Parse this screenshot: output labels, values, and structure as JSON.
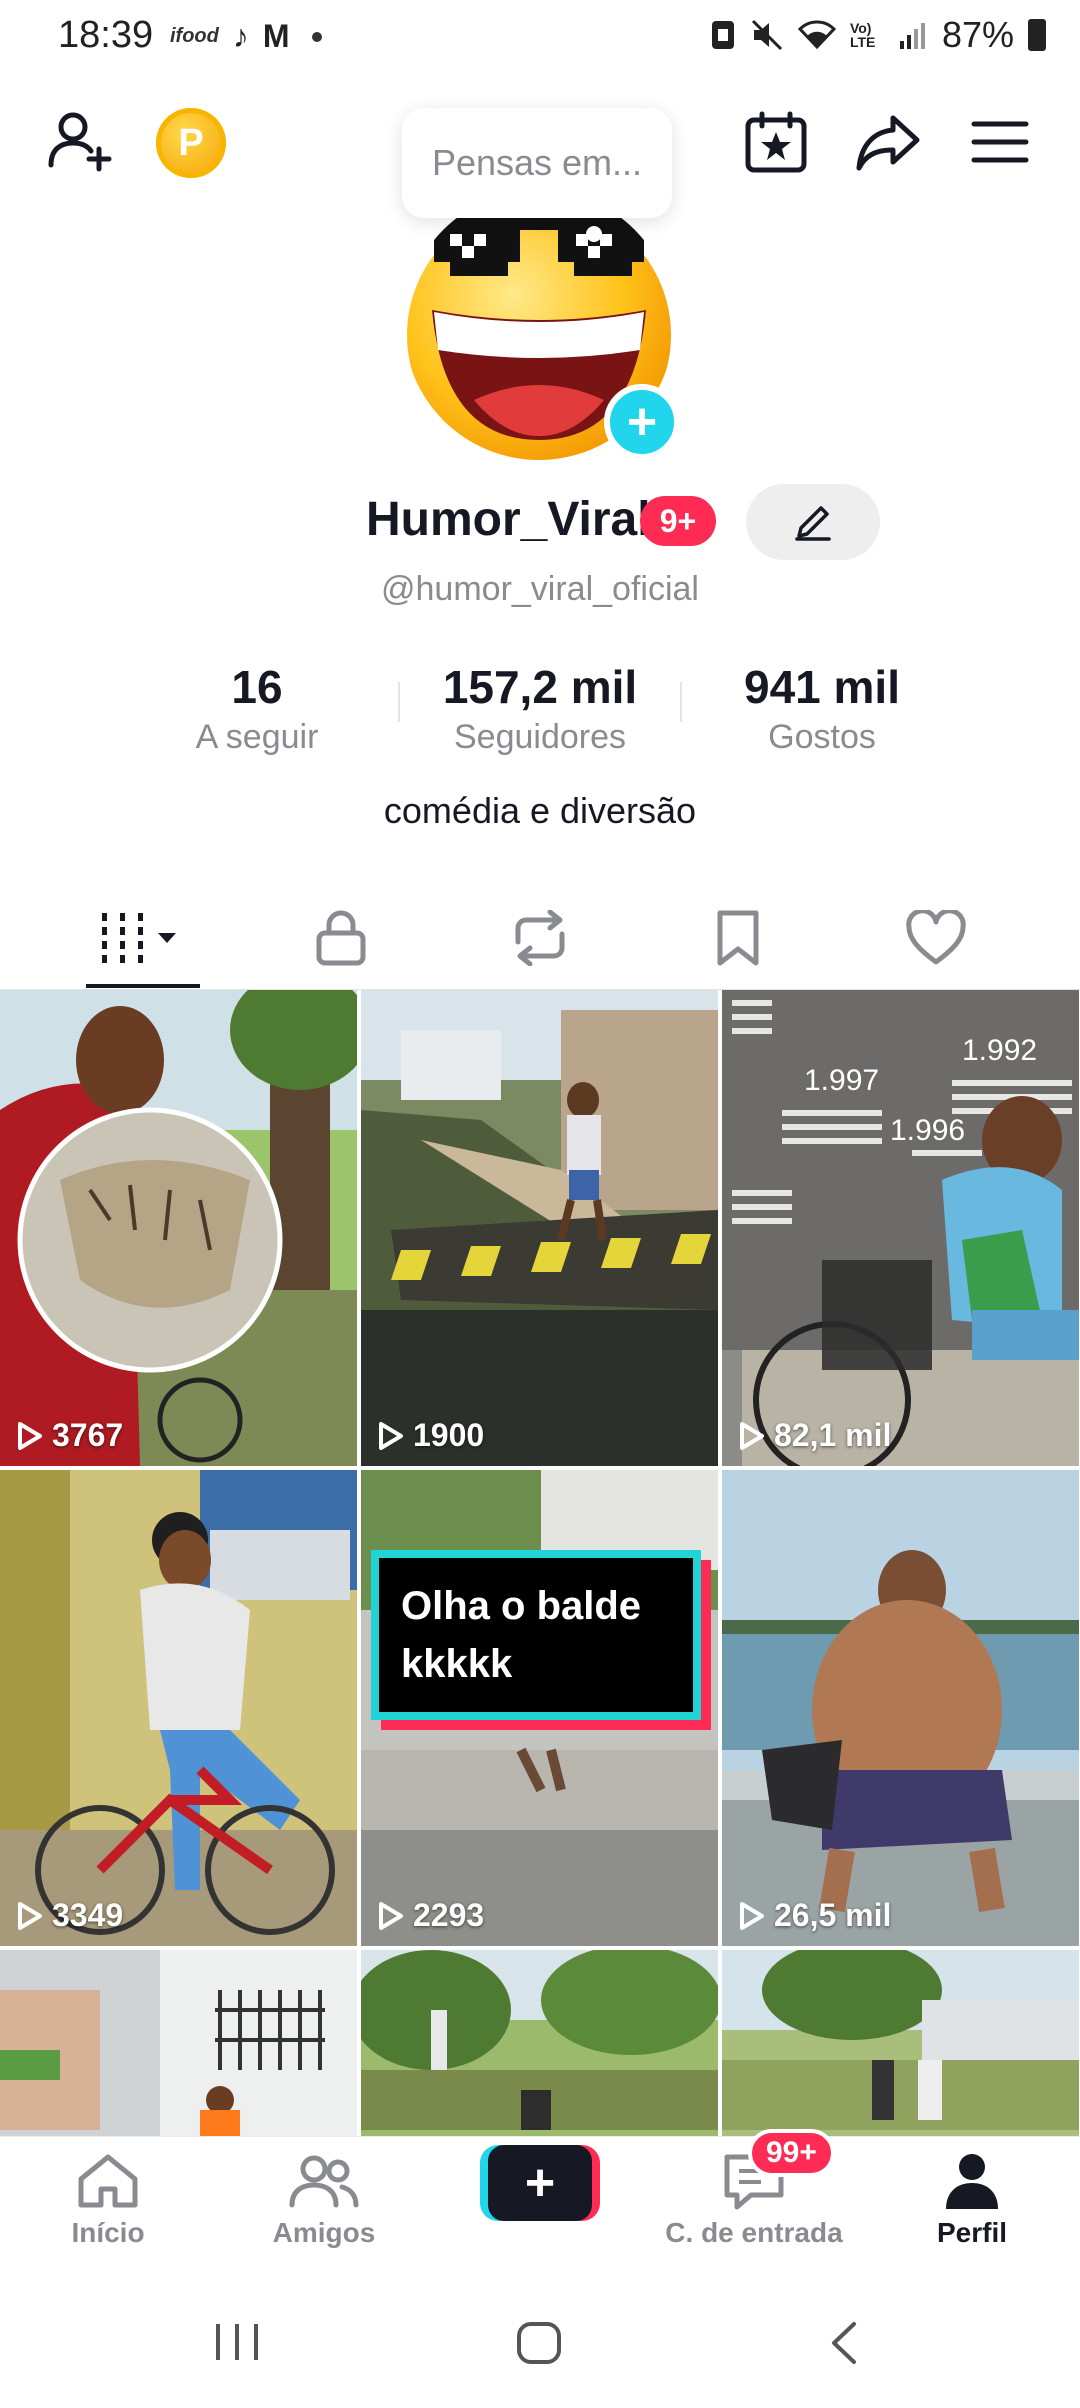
{
  "status_bar": {
    "time": "18:39",
    "left_icons": [
      "ifood-icon",
      "tiktok-icon",
      "gmail-icon",
      "dot"
    ],
    "ifood_text": "ifood",
    "battery": "87%",
    "network": "Vo) LTE"
  },
  "top_bar": {
    "add_friend_icon": "person-plus-icon",
    "coin_letter": "P",
    "thought_bubble": "Pensas em...",
    "calendar_icon": "calendar-star-icon",
    "share_icon": "share-arrow-icon",
    "menu_icon": "hamburger-menu-icon"
  },
  "profile": {
    "display_name": "Humor_Viral",
    "name_badge": "9+",
    "handle": "@humor_viral_oficial",
    "bio": "comédia e diversão",
    "stats": [
      {
        "value": "16",
        "label": "A seguir"
      },
      {
        "value": "157,2 mil",
        "label": "Seguidores"
      },
      {
        "value": "941 mil",
        "label": "Gostos"
      }
    ]
  },
  "tabs": [
    {
      "name": "videos",
      "icon": "grid-bars-icon",
      "active": true
    },
    {
      "name": "private",
      "icon": "lock-icon",
      "active": false
    },
    {
      "name": "reposts",
      "icon": "repost-icon",
      "active": false
    },
    {
      "name": "favorites",
      "icon": "bookmark-icon",
      "active": false
    },
    {
      "name": "liked",
      "icon": "heart-icon",
      "active": false
    }
  ],
  "videos": [
    {
      "views": "3767"
    },
    {
      "views": "1900"
    },
    {
      "views": "82,1 mil"
    },
    {
      "views": "3349"
    },
    {
      "views": "2293",
      "caption": "Olha o balde\nkkkkk"
    },
    {
      "views": "26,5 mil"
    },
    {
      "views": ""
    },
    {
      "views": ""
    },
    {
      "views": ""
    }
  ],
  "thumb_text_3": {
    "year1": "1.997",
    "year2": "1.992",
    "year3": "1.996"
  },
  "bottom_nav": {
    "home": "Início",
    "friends": "Amigos",
    "inbox": "C. de entrada",
    "inbox_badge": "99+",
    "profile": "Perfil"
  },
  "colors": {
    "accent_red": "#fe2c55",
    "accent_cyan": "#20d5ec",
    "text_primary": "#161823",
    "text_secondary": "#8a8b91"
  }
}
